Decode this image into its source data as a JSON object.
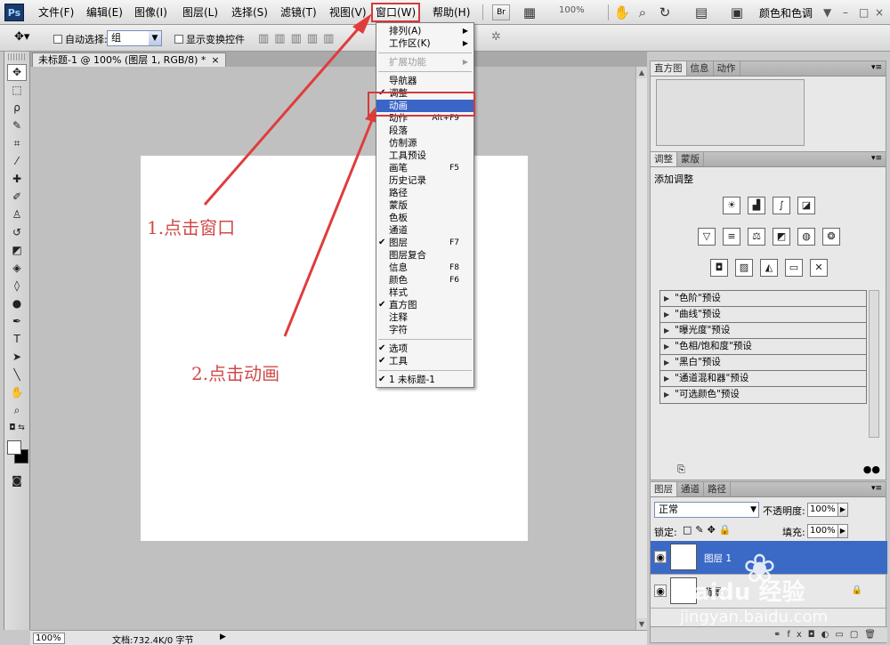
{
  "app": {
    "logo": "Ps"
  },
  "menubar": {
    "items": [
      "文件(F)",
      "编辑(E)",
      "图像(I)",
      "图层(L)",
      "选择(S)",
      "滤镜(T)",
      "视图(V)",
      "窗口(W)",
      "帮助(H)"
    ],
    "br_button": "Br",
    "zoom": "100%",
    "workspace": "颜色和色调",
    "workspace_arrow": "▼",
    "window_controls": [
      "–",
      "□",
      "×"
    ]
  },
  "options": {
    "auto_select_label": "自动选择:",
    "auto_select_value": "组",
    "show_transform_label": "显示变换控件"
  },
  "document": {
    "tab_title": "未标题-1 @ 100% (图层 1, RGB/8) *",
    "close": "×"
  },
  "status": {
    "zoom": "100%",
    "doc_info": "文档:732.4K/0 字节",
    "arrow": "▶"
  },
  "annotations": {
    "step1": "1.点击窗口",
    "step2": "2.点击动画",
    "arrow_color": "#e03c3c"
  },
  "window_menu": {
    "items": [
      {
        "label": "排列(A)",
        "checked": false,
        "submenu": true,
        "disabled": false,
        "highlight": false,
        "shortcut": ""
      },
      {
        "label": "工作区(K)",
        "checked": false,
        "submenu": true,
        "disabled": false,
        "highlight": false,
        "shortcut": ""
      },
      {
        "label": "扩展功能",
        "checked": false,
        "submenu": true,
        "disabled": true,
        "highlight": false,
        "shortcut": ""
      },
      {
        "label": "导航器",
        "checked": false,
        "submenu": false,
        "disabled": false,
        "highlight": false,
        "shortcut": ""
      },
      {
        "label": "调整",
        "checked": true,
        "submenu": false,
        "disabled": false,
        "highlight": false,
        "shortcut": ""
      },
      {
        "label": "动画",
        "checked": false,
        "submenu": false,
        "disabled": false,
        "highlight": true,
        "shortcut": ""
      },
      {
        "label": "动作",
        "checked": false,
        "submenu": false,
        "disabled": false,
        "highlight": false,
        "shortcut": "Alt+F9"
      },
      {
        "label": "段落",
        "checked": false,
        "submenu": false,
        "disabled": false,
        "highlight": false,
        "shortcut": ""
      },
      {
        "label": "仿制源",
        "checked": false,
        "submenu": false,
        "disabled": false,
        "highlight": false,
        "shortcut": ""
      },
      {
        "label": "工具预设",
        "checked": false,
        "submenu": false,
        "disabled": false,
        "highlight": false,
        "shortcut": ""
      },
      {
        "label": "画笔",
        "checked": false,
        "submenu": false,
        "disabled": false,
        "highlight": false,
        "shortcut": "F5"
      },
      {
        "label": "历史记录",
        "checked": false,
        "submenu": false,
        "disabled": false,
        "highlight": false,
        "shortcut": ""
      },
      {
        "label": "路径",
        "checked": false,
        "submenu": false,
        "disabled": false,
        "highlight": false,
        "shortcut": ""
      },
      {
        "label": "蒙版",
        "checked": false,
        "submenu": false,
        "disabled": false,
        "highlight": false,
        "shortcut": ""
      },
      {
        "label": "色板",
        "checked": false,
        "submenu": false,
        "disabled": false,
        "highlight": false,
        "shortcut": ""
      },
      {
        "label": "通道",
        "checked": false,
        "submenu": false,
        "disabled": false,
        "highlight": false,
        "shortcut": ""
      },
      {
        "label": "图层",
        "checked": true,
        "submenu": false,
        "disabled": false,
        "highlight": false,
        "shortcut": "F7"
      },
      {
        "label": "图层复合",
        "checked": false,
        "submenu": false,
        "disabled": false,
        "highlight": false,
        "shortcut": ""
      },
      {
        "label": "信息",
        "checked": false,
        "submenu": false,
        "disabled": false,
        "highlight": false,
        "shortcut": "F8"
      },
      {
        "label": "颜色",
        "checked": false,
        "submenu": false,
        "disabled": false,
        "highlight": false,
        "shortcut": "F6"
      },
      {
        "label": "样式",
        "checked": false,
        "submenu": false,
        "disabled": false,
        "highlight": false,
        "shortcut": ""
      },
      {
        "label": "直方图",
        "checked": true,
        "submenu": false,
        "disabled": false,
        "highlight": false,
        "shortcut": ""
      },
      {
        "label": "注释",
        "checked": false,
        "submenu": false,
        "disabled": false,
        "highlight": false,
        "shortcut": ""
      },
      {
        "label": "字符",
        "checked": false,
        "submenu": false,
        "disabled": false,
        "highlight": false,
        "shortcut": ""
      },
      {
        "label": "选项",
        "checked": true,
        "submenu": false,
        "disabled": false,
        "highlight": false,
        "shortcut": ""
      },
      {
        "label": "工具",
        "checked": true,
        "submenu": false,
        "disabled": false,
        "highlight": false,
        "shortcut": ""
      },
      {
        "label": "1 未标题-1",
        "checked": true,
        "submenu": false,
        "disabled": false,
        "highlight": false,
        "shortcut": ""
      }
    ]
  },
  "panels": {
    "top_tabs": [
      "直方图",
      "信息",
      "动作"
    ],
    "adjust_tabs": [
      "调整",
      "蒙版"
    ],
    "adjust_title": "添加调整",
    "presets": [
      "\"色阶\"预设",
      "\"曲线\"预设",
      "\"曝光度\"预设",
      "\"色相/饱和度\"预设",
      "\"黑白\"预设",
      "\"通道混和器\"预设",
      "\"可选颜色\"预设"
    ],
    "layer_tabs": [
      "图层",
      "通道",
      "路径"
    ],
    "blend_mode": "正常",
    "opacity_label": "不透明度:",
    "opacity_value": "100%",
    "lock_label": "锁定:",
    "fill_label": "填充:",
    "fill_value": "100%",
    "layers": [
      "图层 1",
      "背景"
    ]
  },
  "watermark": {
    "text": "Baidu 经验",
    "url": "jingyan.baidu.com"
  }
}
